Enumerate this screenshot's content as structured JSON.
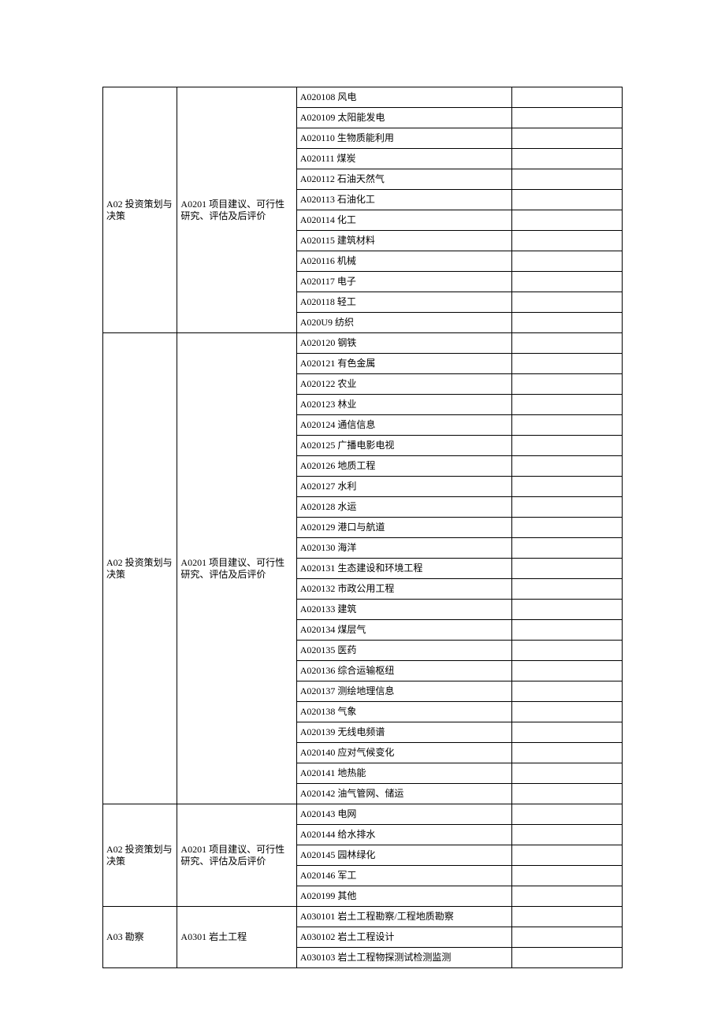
{
  "sections": [
    {
      "col1": "A02 投资策划与决策",
      "col2": "A0201 项目建议、可行性研究、评估及后评价",
      "items": [
        "A020108 风电",
        "A020109 太阳能发电",
        "A020110 生物质能利用",
        "A020111 煤炭",
        "A020112 石油天然气",
        "A020113 石油化工",
        "A020114 化工",
        "A020115 建筑材料",
        "A020116 机械",
        "A020117 电子",
        "A020118 轻工",
        "A020U9 纺织"
      ]
    },
    {
      "col1": "A02 投资策划与决策",
      "col2": "A0201 项目建议、可行性研究、评估及后评价",
      "items": [
        "A020120 钢铁",
        "A020121 有色金属",
        "A020122 农业",
        "A020123 林业",
        "A020124 通信信息",
        "A020125 广播电影电视",
        "A020126 地质工程",
        "A020127 水利",
        "A020128 水运",
        "A020129 港口与航道",
        "A020130 海洋",
        "A020131 生态建设和环境工程",
        "A020132 市政公用工程",
        "A020133 建筑",
        "A020134 煤层气",
        "A020135 医药",
        "A020136 综合运输枢纽",
        "A020137 测绘地理信息",
        "A020138 气象",
        "A020139 无线电频谱",
        "A020140 应对气候变化",
        "A020141 地热能",
        "A020142 油气管网、储运"
      ]
    },
    {
      "col1": "A02 投资策划与决策",
      "col2": "A0201 项目建议、可行性研究、评估及后评价",
      "items": [
        "A020143 电网",
        "A020144 给水排水",
        "A020145 园林绿化",
        "A020146 军工",
        "A020199 其他"
      ]
    },
    {
      "col1": "A03 勘察",
      "col2": "A0301 岩土工程",
      "items": [
        "A030101 岩土工程勘察/工程地质勘察",
        "A030102 岩土工程设计",
        "A030103 岩土工程物探测试检测监测"
      ]
    }
  ]
}
